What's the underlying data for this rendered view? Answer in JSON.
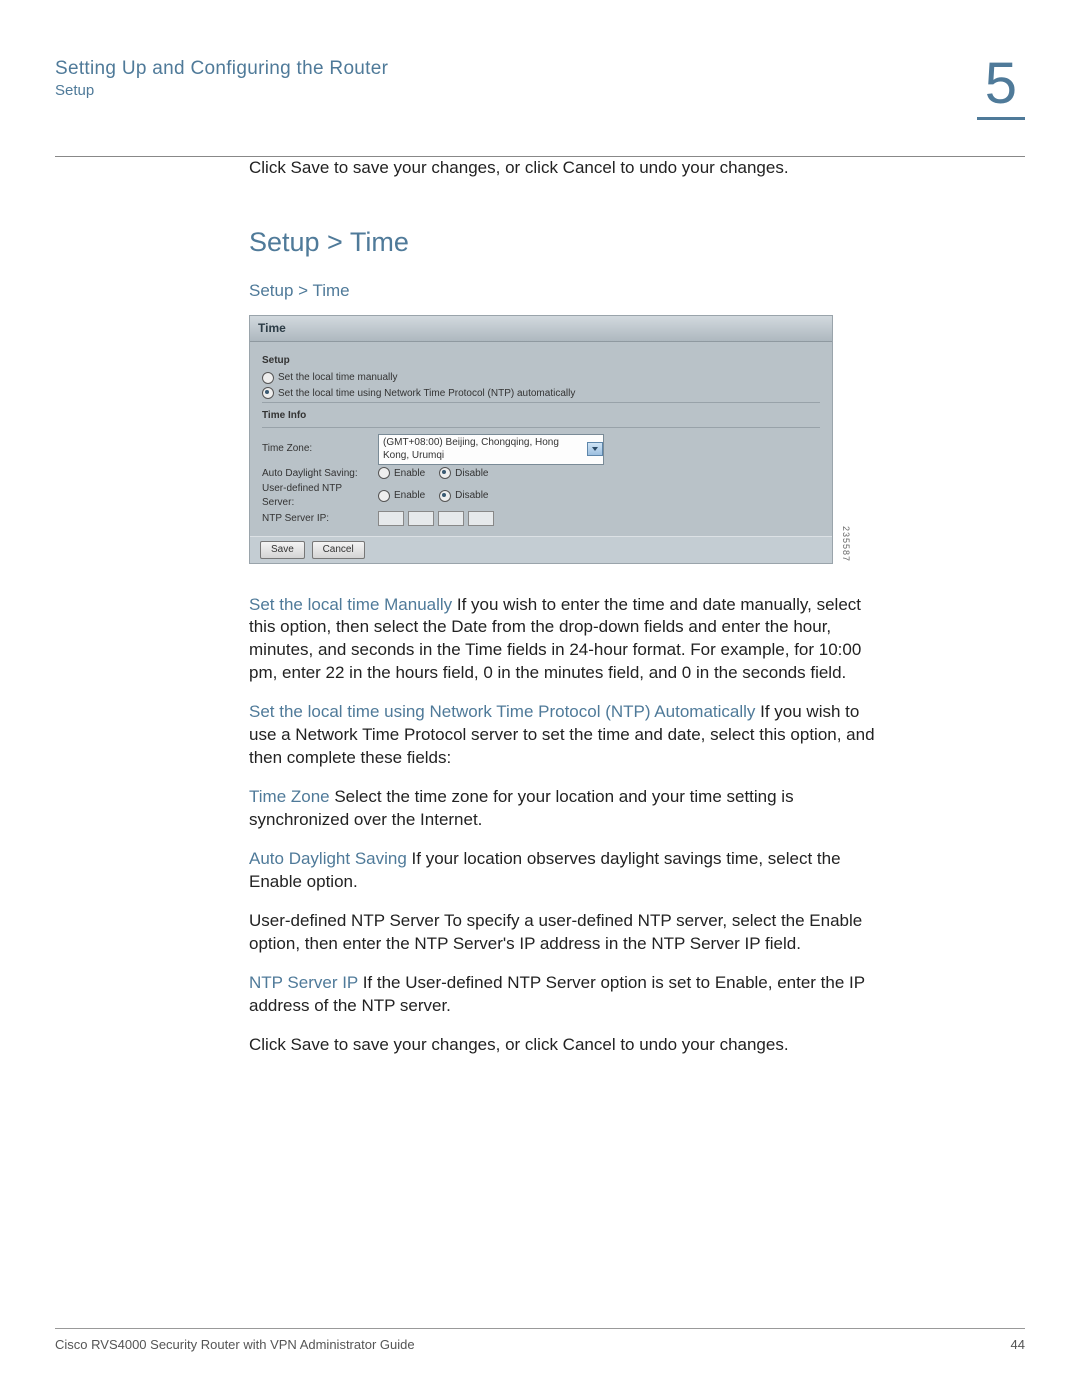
{
  "header": {
    "title": "Setting Up and Configuring the Router",
    "subtitle": "Setup",
    "chapter": "5"
  },
  "intro_line": "Click Save to save your changes, or click Cancel to undo your changes.",
  "section_heading": "Setup > Time",
  "subsection_heading": "Setup > Time",
  "ui": {
    "title": "Time",
    "group_setup": "Setup",
    "opt_manual": "Set the local time manually",
    "opt_ntp": "Set the local time using Network Time Protocol (NTP) automatically",
    "group_info": "Time Info",
    "tz_label": "Time Zone:",
    "tz_value": "(GMT+08:00) Beijing, Chongqing, Hong Kong, Urumqi",
    "dls_label": "Auto Daylight Saving:",
    "enable": "Enable",
    "disable": "Disable",
    "udntp_label": "User-defined NTP Server:",
    "ntpip_label": "NTP Server IP:",
    "save": "Save",
    "cancel": "Cancel",
    "sidenum": "235587"
  },
  "body": {
    "p1_lead": "Set the local time Manually",
    "p1_rest": " If you wish to enter the time and date manually, select this option, then select the Date from the drop-down fields and enter the hour, minutes, and seconds in the Time fields in 24-hour format. For example, for 10:00 pm, enter 22 in the hours field, 0 in the minutes field, and 0 in the seconds field.",
    "p2_lead": "Set the local time using Network Time Protocol (NTP) Automatically",
    "p2_rest": " If you wish to use a Network Time Protocol server to set the time and date, select this option, and then complete these fields:",
    "p3_lead": "Time Zone",
    "p3_rest": " Select the time zone for your location and your time setting is synchronized over the Internet.",
    "p4_lead": "Auto Daylight Saving",
    "p4_rest": " If your location observes daylight savings time, select the Enable option.",
    "p5": "User-defined NTP Server To specify a user-defined NTP server, select the Enable option, then enter the NTP Server's IP address in the NTP Server IP field.",
    "p6_lead": "NTP Server IP",
    "p6_rest": " If the User-defined NTP Server option is set to Enable, enter the IP address of the NTP server.",
    "p7": "Click Save to save your changes, or click Cancel to undo your changes."
  },
  "footer": {
    "left": "Cisco RVS4000 Security Router with VPN Administrator Guide",
    "right": "44"
  }
}
